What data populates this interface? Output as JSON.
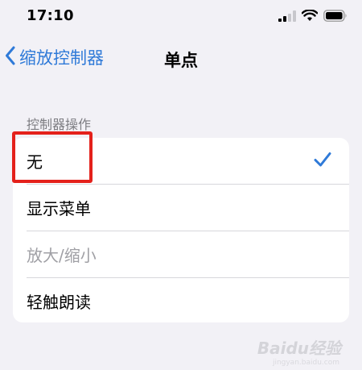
{
  "status_bar": {
    "time": "17:10",
    "icons": [
      "signal-icon",
      "wifi-icon",
      "battery-icon"
    ]
  },
  "nav": {
    "back_label": "缩放控制器",
    "title": "单点"
  },
  "section": {
    "header": "控制器操作"
  },
  "options": [
    {
      "label": "无",
      "selected": true,
      "enabled": true
    },
    {
      "label": "显示菜单",
      "selected": false,
      "enabled": true
    },
    {
      "label": "放大/缩小",
      "selected": false,
      "enabled": false
    },
    {
      "label": "轻触朗读",
      "selected": false,
      "enabled": true
    }
  ],
  "annotation": {
    "color": "#e4211b"
  },
  "watermark": {
    "text": "Baidu经验",
    "subtext": "jingyan.baidu.com"
  },
  "colors": {
    "accent": "#2f7ad8",
    "background": "#f2f1f6",
    "secondary_text": "#7d7d82"
  }
}
